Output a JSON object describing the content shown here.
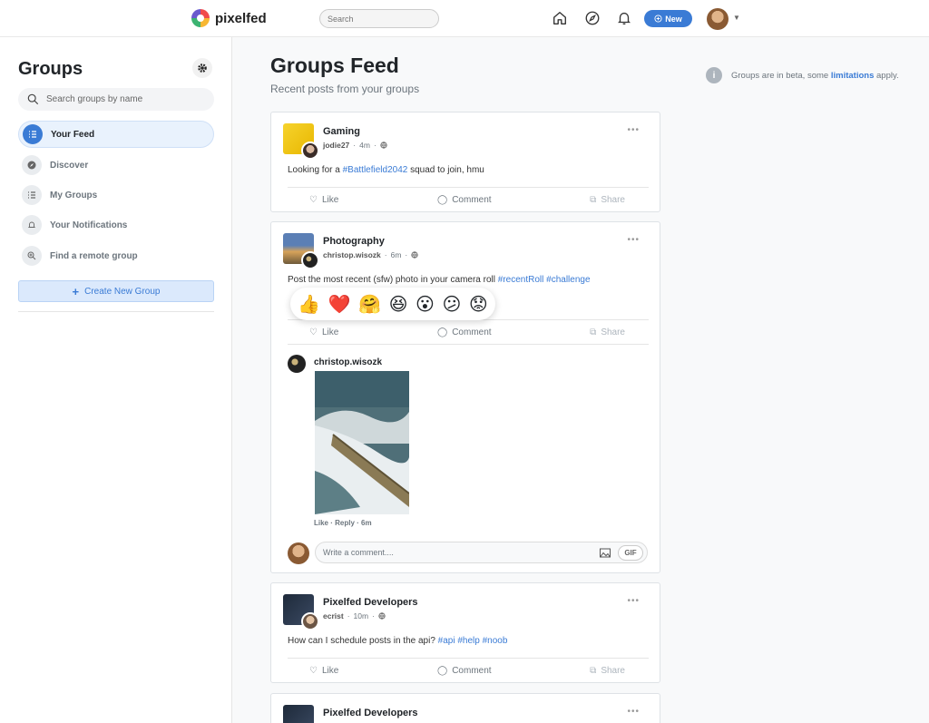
{
  "topbar": {
    "brand": "pixelfed",
    "search_placeholder": "Search",
    "new_label": "New"
  },
  "sidebar": {
    "title": "Groups",
    "search_placeholder": "Search groups by name",
    "items": [
      {
        "label": "Your Feed"
      },
      {
        "label": "Discover"
      },
      {
        "label": "My Groups"
      },
      {
        "label": "Your Notifications"
      },
      {
        "label": "Find a remote group"
      }
    ],
    "create_label": "Create New Group"
  },
  "main": {
    "title": "Groups Feed",
    "subtitle": "Recent posts from your groups",
    "beta_text": "Groups are in beta, some",
    "beta_link": "limitations",
    "beta_suffix": "apply."
  },
  "actions": {
    "like": "Like",
    "comment": "Comment",
    "share": "Share"
  },
  "posts": [
    {
      "group": "Gaming",
      "user": "jodie27",
      "time": "4m",
      "text": "Looking for a",
      "tags": [
        "#Battlefield2042"
      ],
      "text_after": "squad to join, hmu"
    },
    {
      "group": "Photography",
      "user": "christop.wisozk",
      "time": "6m",
      "text": "Post the most recent (sfw) photo in your camera roll",
      "tags": [
        "#recentRoll",
        "#challenge"
      ],
      "comment": {
        "user": "christop.wisozk",
        "like": "Like",
        "reply": "Reply",
        "time": "6m"
      },
      "write_placeholder": "Write a comment....",
      "gif_label": "GIF"
    },
    {
      "group": "Pixelfed Developers",
      "user": "ecrist",
      "time": "10m",
      "text": "How can I schedule posts in the api?",
      "tags": [
        "#api",
        "#help",
        "#noob"
      ]
    },
    {
      "group": "Pixelfed Developers"
    }
  ],
  "reactions": [
    "👍",
    "❤️",
    "🤗",
    "😆",
    "😮",
    "😕",
    "😟"
  ]
}
